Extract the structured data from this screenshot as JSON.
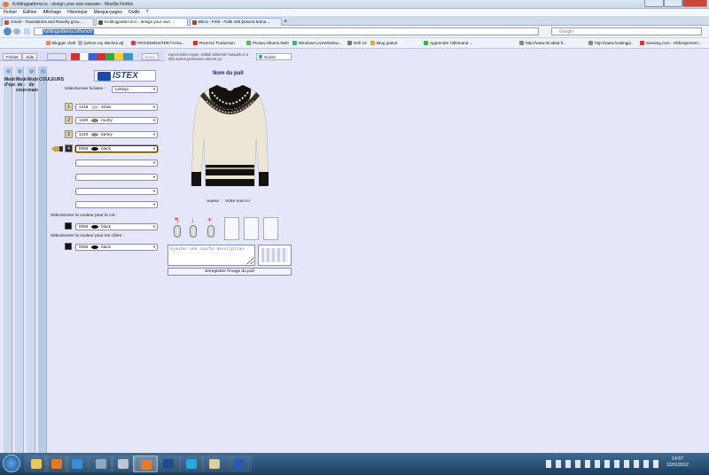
{
  "window": {
    "title": "Knittingpatterns.is - design your own sweater - Mozilla Firefox"
  },
  "menu": [
    "Fichier",
    "Édition",
    "Affichage",
    "Historique",
    "Marque-pages",
    "Outils",
    "?"
  ],
  "tabs": [
    {
      "label": "Gmail - Translations and Ravelry grou...",
      "icon_color": "#d44"
    },
    {
      "label": "Knittingpatterns.is - design your own ...",
      "icon_color": "#555"
    },
    {
      "label": "BB.is - Frétt - Fokk 400 þúsund króna ...",
      "icon_color": "#c33"
    }
  ],
  "address": {
    "url": "knittingpatterns.is/french/"
  },
  "search": {
    "placeholder": "Google"
  },
  "bookmarks": [
    {
      "label": "Blogger draft",
      "color": "#e86"
    },
    {
      "label": "[where my stitches at]",
      "color": "#aac"
    },
    {
      "label": "PRICEMINISTER l'Acha...",
      "color": "#c44"
    },
    {
      "label": "Reverso Traduction",
      "color": "#c33"
    },
    {
      "label": "Picasa Albums Web",
      "color": "#6a6"
    },
    {
      "label": "Windows LiveWindow...",
      "color": "#4a8"
    },
    {
      "label": "Defi 13",
      "color": "#777"
    },
    {
      "label": "Blog gratuit",
      "color": "#da4"
    },
    {
      "label": "Apprendre l'allemand ...",
      "color": "#4a4"
    },
    {
      "label": "http://www.tricotkal.fr...",
      "color": "#888"
    },
    {
      "label": "http://www.hostingpi...",
      "color": "#888"
    },
    {
      "label": "Servimg.com - Hébergement...",
      "color": "#d33"
    }
  ],
  "page_toolbar": {
    "file": "Fichier",
    "help": "Aide",
    "done": "Done",
    "like_text": "Ágnes Dúfu Árgan, Sóllah Sólverstr Yasuark et 3 962 autres personnes aiment ça.",
    "like_btn": "Suivre"
  },
  "side_tabs": [
    "Modèles d'épaules",
    "Modèles de corps",
    "Modèles de manches",
    "COULEURS"
  ],
  "brand": "ÍSTEX",
  "wool": {
    "label": "Sélectionner la laine :",
    "value": "Léttlopi"
  },
  "colors": [
    {
      "n": "1",
      "code": "1418",
      "name": "straw",
      "swatch": "#cfc6b4",
      "active": false
    },
    {
      "n": "2",
      "code": "1420",
      "name": "murky",
      "swatch": "#8a7d6d",
      "active": false
    },
    {
      "n": "3",
      "code": "1419",
      "name": "barley",
      "swatch": "#9b8a77",
      "active": false
    },
    {
      "n": "4",
      "code": "0059",
      "name": "black",
      "swatch": "#111111",
      "active": true
    },
    {
      "n": "",
      "code": "",
      "name": "",
      "swatch": "",
      "active": false
    },
    {
      "n": "",
      "code": "",
      "name": "",
      "swatch": "",
      "active": false
    },
    {
      "n": "",
      "code": "",
      "name": "",
      "swatch": "",
      "active": false
    },
    {
      "n": "",
      "code": "",
      "name": "",
      "swatch": "",
      "active": false
    }
  ],
  "collar": {
    "label": "Sélectionner la couleur pour le col :",
    "code": "0059",
    "name": "black"
  },
  "ribs": {
    "label": "Sélectionner la couleur pour les côtes :",
    "code": "0059",
    "name": "black"
  },
  "design": {
    "title": "Nom du pull",
    "author_label": "Auteur :",
    "author_value": "Votre nom ici"
  },
  "description": {
    "placeholder": "Ajouter une courte description"
  },
  "save_label": "Enregistrer l'image du pull",
  "clock": {
    "time": "14:57",
    "date": "12/01/2012"
  },
  "palette": {
    "sweater_bg": "#ece6d6",
    "sweater_dark": "#15110e",
    "page_bg": "#e6e6fb",
    "accent": "#1d4aa8"
  }
}
